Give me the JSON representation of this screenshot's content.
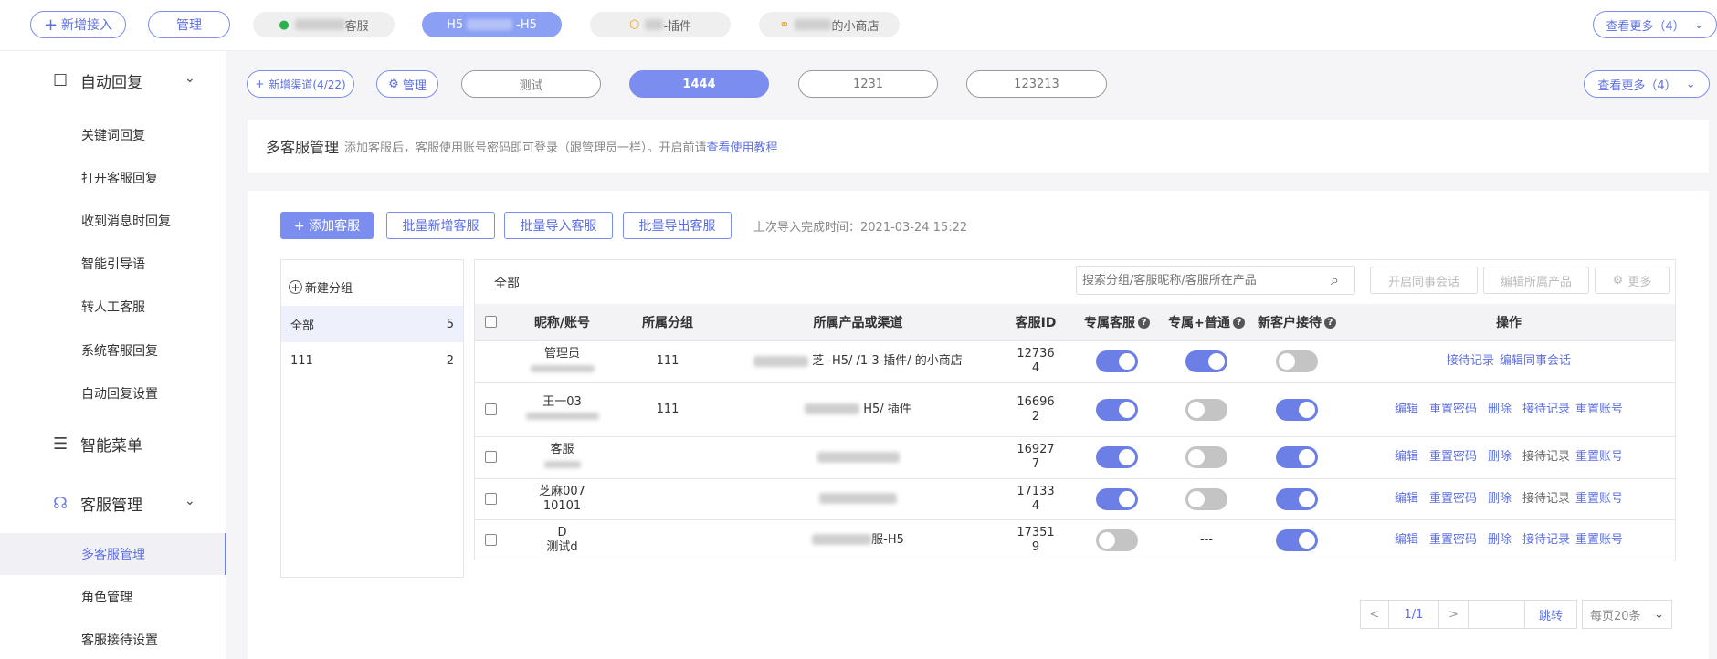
{
  "topbar": {
    "add_label": "新增接入",
    "manage_label": "管理",
    "tabs": [
      {
        "label": "客服",
        "icon": "wechat-icon"
      },
      {
        "label": "H5",
        "label2": "-H5"
      },
      {
        "label": "-插件",
        "icon": "box-icon"
      },
      {
        "label": "的小商店",
        "icon": "link-icon"
      }
    ],
    "more_label": "查看更多（4）"
  },
  "channelbar": {
    "add_label": "新增渠道(4/22)",
    "manage_label": "管理",
    "channels": [
      "测试",
      "1444",
      "1231",
      "123213"
    ],
    "active_index": 1,
    "more_label": "查看更多（4）"
  },
  "sidebar": {
    "groups": [
      {
        "label": "自动回复",
        "icon": "message-icon",
        "items": [
          "关键词回复",
          "打开客服回复",
          "收到消息时回复",
          "智能引导语",
          "转人工客服",
          "系统客服回复",
          "自动回复设置"
        ]
      },
      {
        "label": "智能菜单",
        "icon": "list-icon"
      },
      {
        "label": "客服管理",
        "icon": "headset-icon",
        "items": [
          "多客服管理",
          "角色管理",
          "客服接待设置"
        ]
      }
    ]
  },
  "intro": {
    "title": "多客服管理",
    "desc": "添加客服后，客服使用账号密码即可登录（跟管理员一样）。开启前请",
    "link": "查看使用教程"
  },
  "actions": {
    "add": "+ 添加客服",
    "batch_add": "批量新增客服",
    "batch_import": "批量导入客服",
    "batch_export": "批量导出客服",
    "last_import": "上次导入完成时间：2021-03-24 15:22"
  },
  "groups_panel": {
    "new_group": "新建分组",
    "groups": [
      {
        "name": "全部",
        "count": "5"
      },
      {
        "name": "111",
        "count": "2"
      }
    ]
  },
  "table": {
    "tab_label": "全部",
    "search_placeholder": "搜索分组/客服昵称/客服所在产品",
    "btn_session": "开启同事会话",
    "btn_edit_product": "编辑所属产品",
    "btn_more": "更多",
    "headers": [
      "昵称/账号",
      "所属分组",
      "所属产品或渠道",
      "客服ID",
      "专属客服",
      "专属+普通",
      "新客户接待",
      "操作"
    ],
    "rows": [
      {
        "nick": "管理员",
        "account": "",
        "group": "111",
        "product": "芝 -H5/ /1 3-插件/ 的小商店",
        "id1": "12736",
        "id2": "4",
        "exclusive": true,
        "mixed": "on",
        "newcust": false,
        "ops": [
          "接待记录",
          "编辑同事会话"
        ]
      },
      {
        "nick": "王一03",
        "account": "",
        "group": "111",
        "product": "H5/ 插件",
        "id1": "16696",
        "id2": "2",
        "exclusive": true,
        "mixed": "off",
        "newcust": true,
        "ops": [
          "编辑",
          "重置密码",
          "删除",
          "接待记录",
          "重置账号"
        ]
      },
      {
        "nick": "客服",
        "account": "",
        "group": "",
        "product": "",
        "id1": "16927",
        "id2": "7",
        "exclusive": true,
        "mixed": "off",
        "newcust": true,
        "ops": [
          "编辑",
          "重置密码",
          "删除",
          "接待记录",
          "重置账号"
        ]
      },
      {
        "nick": "芝麻007",
        "account": "10101",
        "group": "",
        "product": "",
        "id1": "17133",
        "id2": "4",
        "exclusive": true,
        "mixed": "off",
        "newcust": true,
        "ops": [
          "编辑",
          "重置密码",
          "删除",
          "接待记录",
          "重置账号"
        ]
      },
      {
        "nick": "D",
        "account": "测试d",
        "group": "",
        "product": "服-H5",
        "id1": "17351",
        "id2": "9",
        "exclusive": false,
        "mixed": "none",
        "newcust": true,
        "ops": [
          "编辑",
          "重置密码",
          "删除",
          "接待记录",
          "重置账号"
        ]
      }
    ],
    "mixed_none": "---"
  },
  "pager": {
    "prev": "<",
    "page": "1/1",
    "next": ">",
    "jump": "跳转",
    "per_page": "每页20条"
  }
}
